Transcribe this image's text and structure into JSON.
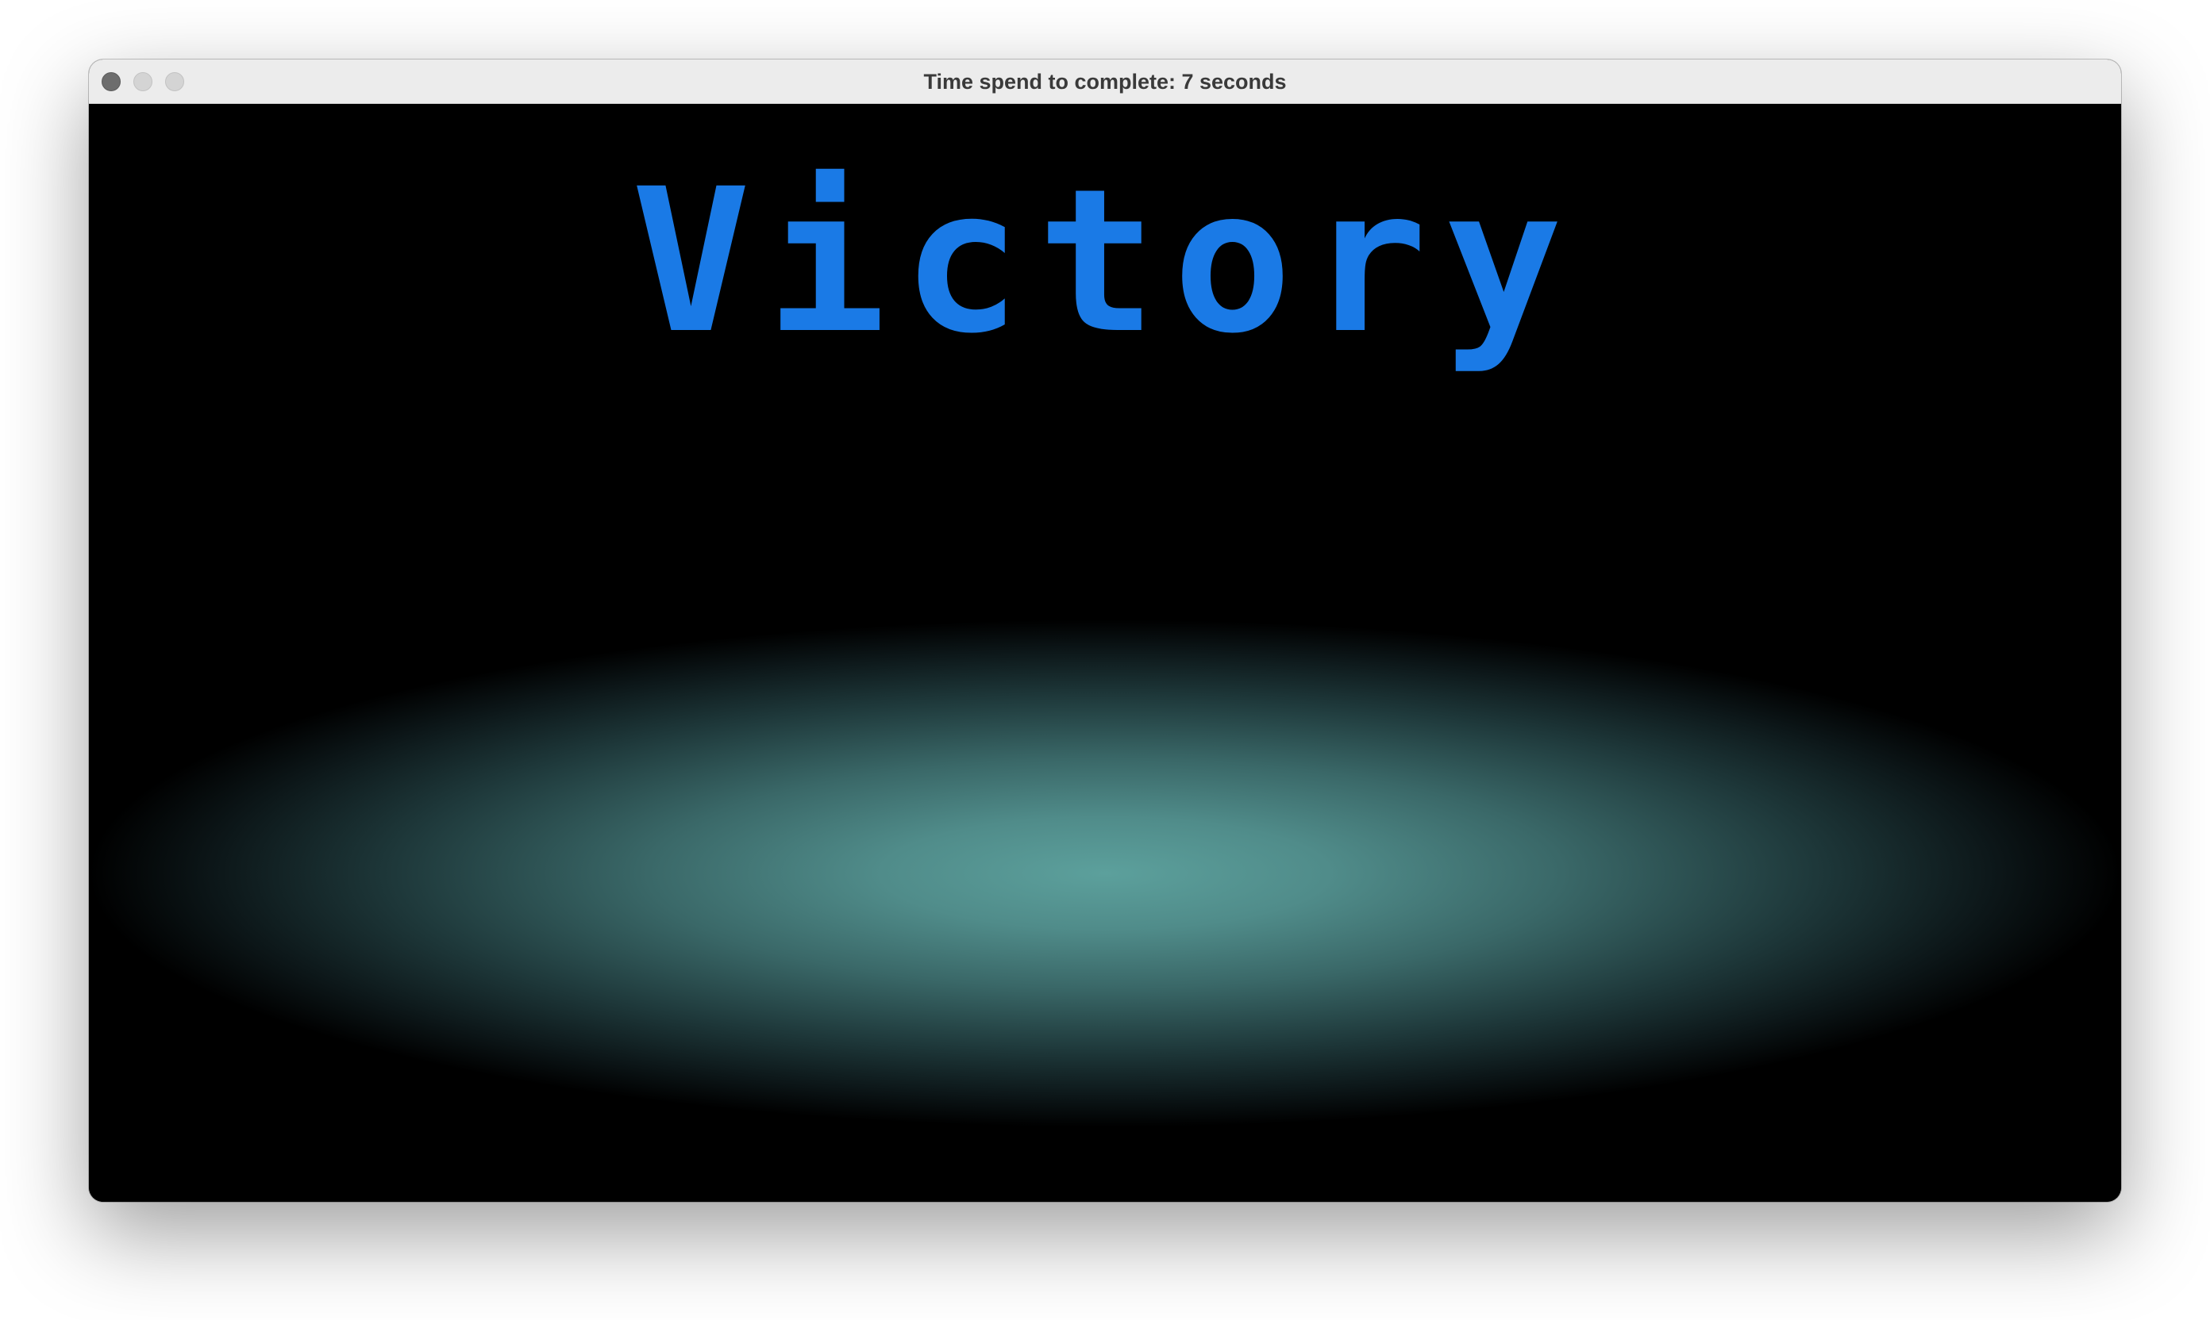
{
  "window": {
    "title": "Time spend to complete: 7 seconds"
  },
  "game": {
    "headline": "Victory",
    "headline_color": "#1a7ae6",
    "glow_color": "#5ca09c",
    "background_color": "#000000"
  }
}
